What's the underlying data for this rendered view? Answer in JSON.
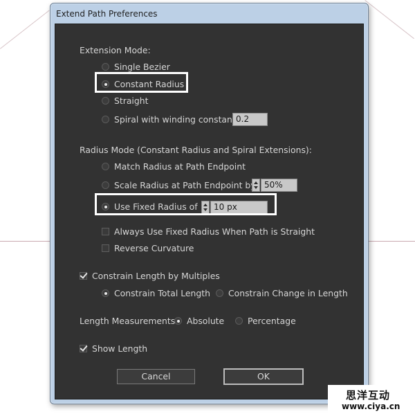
{
  "window": {
    "title": "Extend Path Preferences"
  },
  "extension_mode": {
    "heading": "Extension Mode:",
    "options": [
      {
        "label": "Single Bezier",
        "selected": false
      },
      {
        "label": "Constant Radius",
        "selected": true
      },
      {
        "label": "Straight",
        "selected": false
      },
      {
        "label": "Spiral with winding constant",
        "selected": false
      }
    ],
    "winding_constant": "0.2"
  },
  "radius_mode": {
    "heading": "Radius Mode (Constant Radius and Spiral Extensions):",
    "options": [
      {
        "label": "Match Radius at Path Endpoint",
        "selected": false
      },
      {
        "label": "Scale Radius at Path Endpoint by",
        "selected": false
      },
      {
        "label": "Use Fixed Radius of",
        "selected": true
      }
    ],
    "scale_value": "50%",
    "fixed_value": "10 px",
    "always_fixed_label": "Always Use Fixed Radius When Path is Straight",
    "always_fixed_checked": false,
    "reverse_label": "Reverse Curvature",
    "reverse_checked": false
  },
  "constrain": {
    "label": "Constrain Length by Multiples",
    "checked": true,
    "options": [
      {
        "label": "Constrain Total Length",
        "selected": true
      },
      {
        "label": "Constrain Change in Length",
        "selected": false
      }
    ]
  },
  "length_measurements": {
    "label": "Length Measurements:",
    "options": [
      {
        "label": "Absolute",
        "selected": true
      },
      {
        "label": "Percentage",
        "selected": false
      }
    ]
  },
  "show_length": {
    "label": "Show Length",
    "checked": true
  },
  "buttons": {
    "cancel": "Cancel",
    "ok": "OK"
  },
  "watermark": {
    "line1": "思洋互动",
    "line2": "www.ciya.cn"
  },
  "colors": {
    "dialog_bg": "#323232",
    "highlight": "#ffffff",
    "text": "#d6d6d6"
  }
}
